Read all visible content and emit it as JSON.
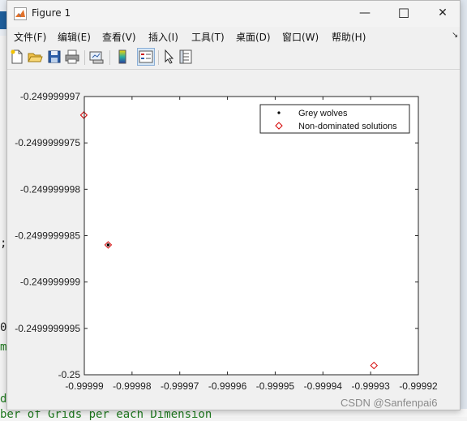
{
  "window": {
    "title": "Figure 1",
    "controls": {
      "minimize": "—",
      "maximize": "☐",
      "close": "✕"
    }
  },
  "menu": {
    "items": [
      "文件(F)",
      "编辑(E)",
      "查看(V)",
      "插入(I)",
      "工具(T)",
      "桌面(D)",
      "窗口(W)",
      "帮助(H)"
    ],
    "overflow_icon": "dock-arrow-icon"
  },
  "toolbar": {
    "buttons": [
      "new-figure-icon",
      "open-file-icon",
      "save-icon",
      "print-icon",
      "link-plot-icon",
      "insert-colorbar-icon",
      "insert-legend-icon",
      "edit-plot-icon",
      "property-inspector-icon"
    ]
  },
  "background": {
    "fragments": [
      "d",
      "m",
      "d",
      "ber of Grids per each Dimension",
      ";",
      "0"
    ]
  },
  "chart_data": {
    "type": "scatter",
    "title": "",
    "xlabel": "",
    "ylabel": "",
    "xlim": [
      -0.99999,
      -0.99992
    ],
    "ylim": [
      -0.25,
      -0.249999997
    ],
    "x_ticks": [
      -0.99999,
      -0.99998,
      -0.99997,
      -0.99996,
      -0.99995,
      -0.99994,
      -0.99993,
      -0.99992
    ],
    "x_tick_labels": [
      "-0.99999",
      "-0.99998",
      "-0.99997",
      "-0.99996",
      "-0.99995",
      "-0.99994",
      "-0.99993",
      "-0.99992"
    ],
    "y_ticks": [
      -0.25,
      -0.2499999995,
      -0.249999999,
      -0.2499999985,
      -0.249999998,
      -0.2499999975,
      -0.249999997
    ],
    "y_tick_labels": [
      "-0.25",
      "-0.2499999995",
      "-0.249999999",
      "-0.2499999985",
      "-0.249999998",
      "-0.2499999975",
      "-0.249999997"
    ],
    "grid": false,
    "legend_position": "top-right",
    "series": [
      {
        "name": "Grey wolves",
        "marker": "point",
        "color": "#000000",
        "points": [
          {
            "x": -0.999985,
            "y": -0.2499999986
          }
        ]
      },
      {
        "name": "Non-dominated solutions",
        "marker": "diamond",
        "color": "#d40000",
        "points": [
          {
            "x": -0.9999901,
            "y": -0.2499999972
          },
          {
            "x": -0.999985,
            "y": -0.2499999986
          },
          {
            "x": -0.9999293,
            "y": -0.2499999999
          }
        ]
      }
    ]
  },
  "watermark": "CSDN @Sanfenpai6"
}
